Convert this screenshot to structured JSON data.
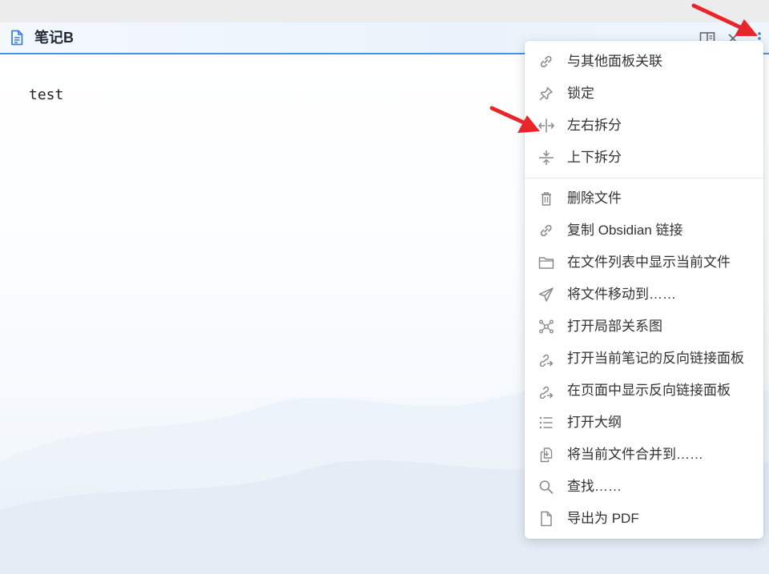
{
  "note": {
    "title": "笔记B",
    "content": "test"
  },
  "header_icons": [
    "file-text-icon",
    "reading-view-icon",
    "close-icon",
    "more-options-icon"
  ],
  "menu": {
    "items": [
      {
        "label": "与其他面板关联",
        "icon": "link-icon"
      },
      {
        "label": "锁定",
        "icon": "pin-icon"
      },
      {
        "label": "左右拆分",
        "icon": "split-vertical-icon"
      },
      {
        "label": "上下拆分",
        "icon": "split-horizontal-icon"
      },
      {
        "label": "删除文件",
        "icon": "trash-icon"
      },
      {
        "label": "复制 Obsidian 链接",
        "icon": "link-icon"
      },
      {
        "label": "在文件列表中显示当前文件",
        "icon": "folder-icon"
      },
      {
        "label": "将文件移动到……",
        "icon": "send-icon"
      },
      {
        "label": "打开局部关系图",
        "icon": "graph-icon"
      },
      {
        "label": "打开当前笔记的反向链接面板",
        "icon": "backlink-icon"
      },
      {
        "label": "在页面中显示反向链接面板",
        "icon": "backlink-icon"
      },
      {
        "label": "打开大纲",
        "icon": "list-icon"
      },
      {
        "label": "将当前文件合并到……",
        "icon": "merge-icon"
      },
      {
        "label": "查找……",
        "icon": "search-icon"
      },
      {
        "label": "导出为 PDF",
        "icon": "file-icon"
      }
    ]
  },
  "colors": {
    "accent": "#4a90e2",
    "arrow": "#e8252b",
    "icon_gray": "#8a8a8a"
  }
}
